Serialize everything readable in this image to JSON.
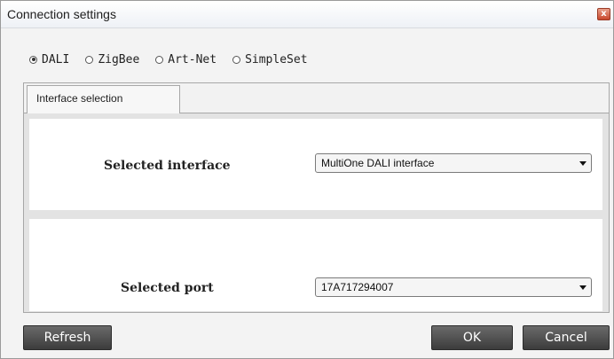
{
  "window": {
    "title": "Connection settings",
    "close_glyph": "x"
  },
  "protocols": [
    {
      "label": "DALI",
      "selected": true
    },
    {
      "label": "ZigBee",
      "selected": false
    },
    {
      "label": "Art-Net",
      "selected": false
    },
    {
      "label": "SimpleSet",
      "selected": false
    }
  ],
  "tabs": {
    "active_label": "Interface selection"
  },
  "interface": {
    "label": "Selected interface",
    "value": "MultiOne DALI interface"
  },
  "port": {
    "label": "Selected port",
    "value": "17A717294007"
  },
  "buttons": {
    "refresh": "Refresh",
    "ok": "OK",
    "cancel": "Cancel"
  },
  "colors": {
    "button_bg": "#4a4a4a",
    "close_button": "#c8472c"
  }
}
